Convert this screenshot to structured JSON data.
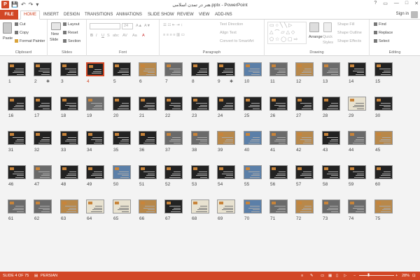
{
  "window": {
    "title": "هنر در تمدن اسلامی.pptx - PowerPoint",
    "app_icon_letter": "P",
    "controls": [
      "?",
      "▭",
      "—",
      "□",
      "✕"
    ]
  },
  "qat": [
    "💾",
    "↶",
    "↷",
    "▾"
  ],
  "tabs": {
    "file": "FILE",
    "items": [
      "HOME",
      "INSERT",
      "DESIGN",
      "TRANSITIONS",
      "ANIMATIONS",
      "SLIDE SHOW",
      "REVIEW",
      "VIEW",
      "ADD-INS"
    ],
    "active": "HOME",
    "sign_in": "Sign in"
  },
  "ribbon": {
    "clipboard": {
      "label": "Clipboard",
      "paste": "Paste",
      "cut": "Cut",
      "copy": "Copy",
      "format_painter": "Format Painter"
    },
    "slides": {
      "label": "Slides",
      "new_slide": "New",
      "new_slide2": "Slide",
      "layout": "Layout",
      "reset": "Reset",
      "section": "Section"
    },
    "font": {
      "label": "Font",
      "size": "24",
      "bold": "B",
      "italic": "I",
      "underline": "U",
      "strike": "S",
      "shadow": "abc",
      "spacing": "AV",
      "case": "Aa",
      "color": "A"
    },
    "paragraph": {
      "label": "Paragraph",
      "text_direction": "Text Direction",
      "align_text": "Align Text",
      "smartart": "Convert to SmartArt"
    },
    "drawing": {
      "label": "Drawing",
      "arrange": "Arrange",
      "quick_styles": "Quick",
      "quick_styles2": "Styles",
      "shape_fill": "Shape Fill",
      "shape_outline": "Shape Outline",
      "shape_effects": "Shape Effects"
    },
    "editing": {
      "label": "Editing",
      "find": "Find",
      "replace": "Replace",
      "select": "Select"
    }
  },
  "slides": {
    "count": 75,
    "selected": 4,
    "starred": [
      2,
      9
    ],
    "photo": [
      6,
      7,
      10,
      11,
      12,
      13,
      19,
      29,
      37,
      38,
      39,
      40,
      41,
      42,
      44,
      45,
      47,
      50,
      55,
      61,
      62,
      63,
      64,
      65,
      66,
      68,
      69,
      70,
      71,
      72,
      73,
      74,
      75
    ],
    "light": [
      29,
      64,
      65,
      68,
      69
    ]
  },
  "status": {
    "slide_info": "SLIDE 4 OF 75",
    "language": "PERSIAN",
    "zoom": "28%"
  }
}
